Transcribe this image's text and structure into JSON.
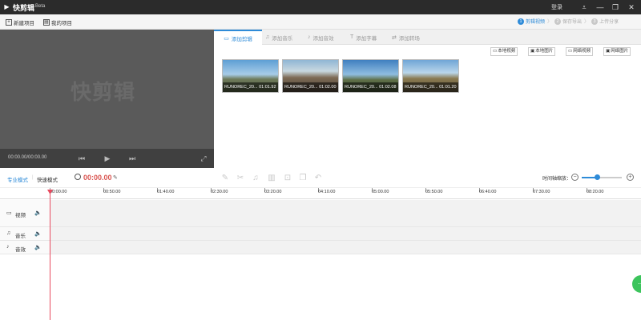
{
  "titlebar": {
    "title": "快剪辑",
    "badge": "Beta",
    "login": "登录",
    "icons": [
      "menu-icon",
      "minimize-icon",
      "restore-icon",
      "close-icon"
    ],
    "menu_glyph": "⩡",
    "minimize_glyph": "—",
    "restore_glyph": "❐",
    "close_glyph": "✕"
  },
  "toolbar": {
    "new_project": "新建项目",
    "my_projects": "我的项目",
    "steps": [
      {
        "num": "1",
        "label": "剪辑视频",
        "active": true
      },
      {
        "num": "2",
        "label": "保存导出",
        "active": false
      },
      {
        "num": "3",
        "label": "上传分享",
        "active": false
      }
    ],
    "step_sep": "〉"
  },
  "preview": {
    "watermark": "快剪辑",
    "timecode": "00:00.00/00:00.00"
  },
  "media": {
    "tabs": [
      {
        "label": "添加剪辑",
        "icon": "video-icon",
        "glyph": "▭",
        "active": true
      },
      {
        "label": "添加音乐",
        "icon": "music-icon",
        "glyph": "♫",
        "active": false
      },
      {
        "label": "添加音效",
        "icon": "sound-effect-icon",
        "glyph": "♪",
        "active": false
      },
      {
        "label": "添加字幕",
        "icon": "text-icon",
        "glyph": "T",
        "active": false
      },
      {
        "label": "添加转场",
        "icon": "transition-icon",
        "glyph": "⇄",
        "active": false
      }
    ],
    "add_buttons": [
      "本地视频",
      "本地图片",
      "网络视频",
      "网络图片"
    ],
    "clips": [
      {
        "label": "RUNOREC_20... 01:01.92"
      },
      {
        "label": "RUNOREC_20... 01:02.00"
      },
      {
        "label": "RUNOREC_20... 01:02.08"
      },
      {
        "label": "RUNOREC_20... 01:01.20"
      }
    ]
  },
  "timeline": {
    "mode_pro": "专业模式",
    "mode_sep": "|",
    "mode_quick": "快速模式",
    "time": "00:00.00",
    "zoom_label": "时间轴缩放：",
    "zoom_level": 0.38,
    "ticks": [
      "00:00.00",
      "00:50.00",
      "01:40.00",
      "02:30.00",
      "03:20.00",
      "04:10.00",
      "05:00.00",
      "05:50.00",
      "06:40.00",
      "07:30.00",
      "08:20.00"
    ],
    "tracks": [
      {
        "label": "视频",
        "icon": "video-track-icon",
        "glyph": "▭"
      },
      {
        "label": "音乐",
        "icon": "music-track-icon",
        "glyph": "♫"
      },
      {
        "label": "音效",
        "icon": "sound-track-icon",
        "glyph": "♪"
      }
    ],
    "volume_glyph": "🔈"
  }
}
